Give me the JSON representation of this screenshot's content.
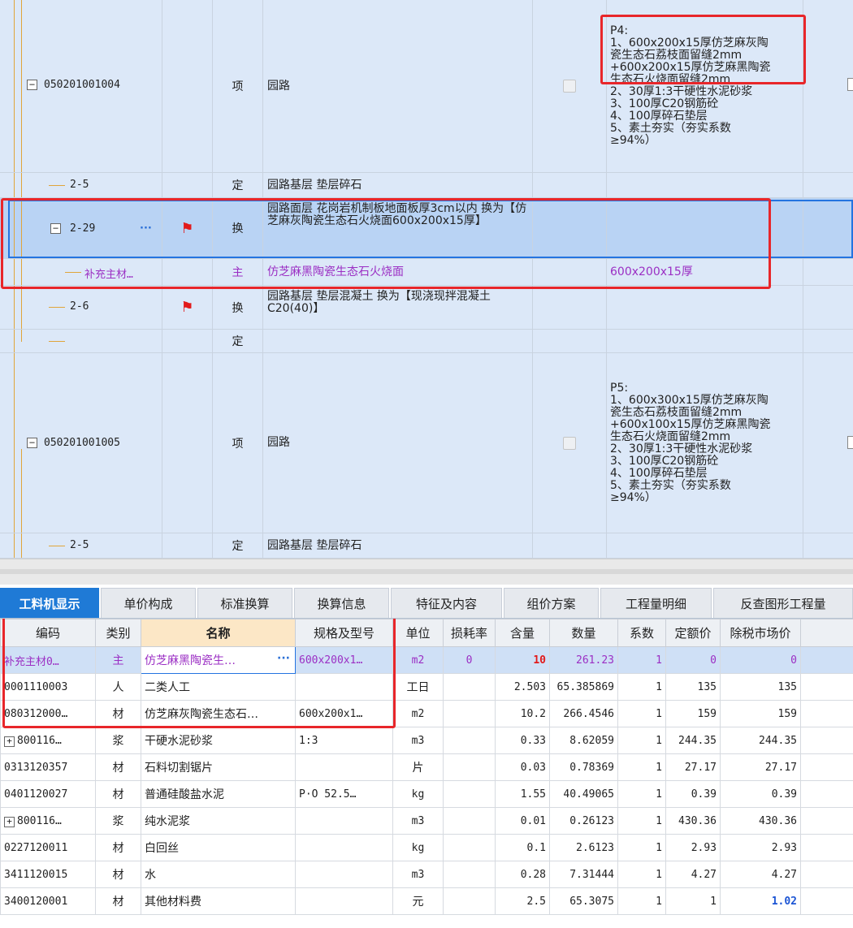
{
  "upper": {
    "rows": [
      {
        "code": "050201001004",
        "type": "项",
        "name": "园路",
        "feature": "P4:\n1、600x200x15厚仿芝麻灰陶\n瓷生态石荔枝面留缝2mm\n+600x200x15厚仿芝麻黑陶瓷\n生态石火烧面留缝2mm\n2、30厚1:3干硬性水泥砂浆\n3、100厚C20钢筋砼\n4、100厚碎石垫层\n5、素土夯实（夯实系数\n≥94%）"
      },
      {
        "code": "2-5",
        "type": "定",
        "name": "园路基层 垫层碎石",
        "feature": ""
      },
      {
        "code": "2-29",
        "type": "换",
        "name": "园路面层 花岗岩机制板地面板厚3cm以内 换为【仿芝麻灰陶瓷生态石火烧面600x200x15厚】",
        "feature": ""
      },
      {
        "code": "补充主材…",
        "type": "主",
        "name": "仿芝麻黑陶瓷生态石火烧面",
        "feature": "600x200x15厚"
      },
      {
        "code": "2-6",
        "type": "换",
        "name": "园路基层 垫层混凝土  换为【现浇现拌混凝土 C20(40)】",
        "feature": ""
      },
      {
        "code": "",
        "type": "定",
        "name": "",
        "feature": ""
      },
      {
        "code": "050201001005",
        "type": "项",
        "name": "园路",
        "feature": "P5:\n1、600x300x15厚仿芝麻灰陶\n瓷生态石荔枝面留缝2mm\n+600x100x15厚仿芝麻黑陶瓷\n生态石火烧面留缝2mm\n2、30厚1:3干硬性水泥砂浆\n3、100厚C20钢筋砼\n4、100厚碎石垫层\n5、素土夯实（夯实系数\n≥94%）"
      },
      {
        "code": "2-5",
        "type": "定",
        "name": "园路基层 垫层碎石",
        "feature": ""
      }
    ],
    "expander_minus": "−",
    "more_dots": "···"
  },
  "tabs": [
    "工料机显示",
    "单价构成",
    "标准换算",
    "换算信息",
    "特征及内容",
    "组价方案",
    "工程量明细",
    "反查图形工程量"
  ],
  "lower": {
    "headers": [
      "编码",
      "类别",
      "名称",
      "规格及型号",
      "单位",
      "损耗率",
      "含量",
      "数量",
      "系数",
      "定额价",
      "除税市场价"
    ],
    "rows": [
      {
        "code": "补充主材0…",
        "cat": "主",
        "name": "仿芝麻黑陶瓷生…",
        "spec": "600x200x1…",
        "unit": "m2",
        "loss": "0",
        "content": "10",
        "qty": "261.23",
        "coef": "1",
        "price": "0",
        "market": "0"
      },
      {
        "code": "0001110003",
        "cat": "人",
        "name": "二类人工",
        "spec": "",
        "unit": "工日",
        "loss": "",
        "content": "2.503",
        "qty": "65.385869",
        "coef": "1",
        "price": "135",
        "market": "135"
      },
      {
        "code": "080312000…",
        "cat": "材",
        "name": "仿芝麻灰陶瓷生态石…",
        "spec": "600x200x1…",
        "unit": "m2",
        "loss": "",
        "content": "10.2",
        "qty": "266.4546",
        "coef": "1",
        "price": "159",
        "market": "159"
      },
      {
        "code": "800116…",
        "cat": "浆",
        "name": "干硬水泥砂浆",
        "spec": "1:3",
        "unit": "m3",
        "loss": "",
        "content": "0.33",
        "qty": "8.62059",
        "coef": "1",
        "price": "244.35",
        "market": "244.35"
      },
      {
        "code": "0313120357",
        "cat": "材",
        "name": "石料切割锯片",
        "spec": "",
        "unit": "片",
        "loss": "",
        "content": "0.03",
        "qty": "0.78369",
        "coef": "1",
        "price": "27.17",
        "market": "27.17"
      },
      {
        "code": "0401120027",
        "cat": "材",
        "name": "普通硅酸盐水泥",
        "spec": "P·O 52.5…",
        "unit": "kg",
        "loss": "",
        "content": "1.55",
        "qty": "40.49065",
        "coef": "1",
        "price": "0.39",
        "market": "0.39"
      },
      {
        "code": "800116…",
        "cat": "浆",
        "name": "纯水泥浆",
        "spec": "",
        "unit": "m3",
        "loss": "",
        "content": "0.01",
        "qty": "0.26123",
        "coef": "1",
        "price": "430.36",
        "market": "430.36"
      },
      {
        "code": "0227120011",
        "cat": "材",
        "name": "白回丝",
        "spec": "",
        "unit": "kg",
        "loss": "",
        "content": "0.1",
        "qty": "2.6123",
        "coef": "1",
        "price": "2.93",
        "market": "2.93"
      },
      {
        "code": "3411120015",
        "cat": "材",
        "name": "水",
        "spec": "",
        "unit": "m3",
        "loss": "",
        "content": "0.28",
        "qty": "7.31444",
        "coef": "1",
        "price": "4.27",
        "market": "4.27"
      },
      {
        "code": "3400120001",
        "cat": "材",
        "name": "其他材料费",
        "spec": "",
        "unit": "元",
        "loss": "",
        "content": "2.5",
        "qty": "65.3075",
        "coef": "1",
        "price": "1",
        "market": "1.02"
      }
    ],
    "expander_plus": "+",
    "more_dots": "···"
  },
  "colors": {
    "accent": "#1f7ad6",
    "highlight_red": "#e8262a",
    "purple": "#9b2fc4"
  }
}
